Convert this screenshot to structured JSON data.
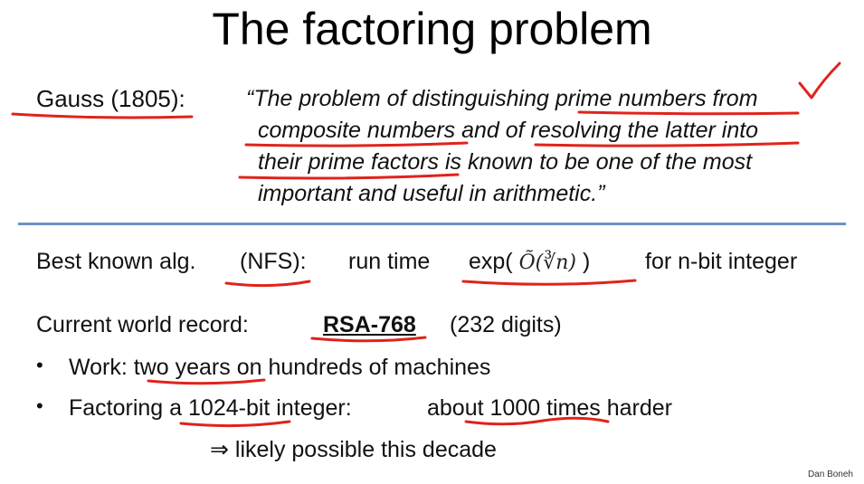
{
  "title": "The factoring problem",
  "gauss": {
    "label": "Gauss (1805):",
    "quote_lines": [
      "“The problem of distinguishing prime numbers from",
      "composite numbers and of resolving the latter into",
      "their prime factors is known to be one of the most",
      "important and useful in arithmetic.”"
    ]
  },
  "nfs": {
    "label": "Best known alg.",
    "alg": "(NFS):",
    "runtime": "run time",
    "formula_prefix": "exp(",
    "formula": "Õ(∛n)",
    "formula_suffix": ")",
    "suffix": "for n-bit integer"
  },
  "record": {
    "label": "Current world record:",
    "name": "RSA-768",
    "digits": "(232 digits)"
  },
  "bullets": [
    {
      "dot": "•",
      "text": "Work:  two years on hundreds of machines"
    },
    {
      "dot": "•",
      "text": "Factoring a 1024-bit integer:",
      "text2": "about 1000 times harder"
    }
  ],
  "implication": "⇒  likely possible this decade",
  "credit": "Dan Boneh",
  "colors": {
    "divider": "#6f8fc7",
    "annotation": "#e0231b"
  }
}
